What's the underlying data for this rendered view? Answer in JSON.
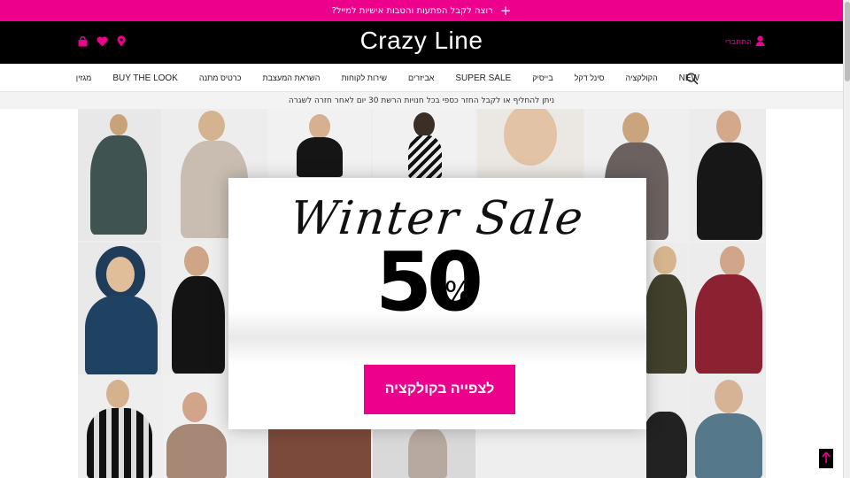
{
  "promo": {
    "text": "רוצה לקבל הפתעות והטבות אישיות למייל?",
    "icon": "plus-icon"
  },
  "header": {
    "logo": "Crazy Line",
    "signin_label": "התחברי",
    "icons": [
      "location-icon",
      "heart-icon",
      "cart-icon"
    ]
  },
  "nav": {
    "items": [
      {
        "label": "NEW"
      },
      {
        "label": "הקולקציה"
      },
      {
        "label": "סינל דקל"
      },
      {
        "label": "בייסיק"
      },
      {
        "label": "SUPER SALE"
      },
      {
        "label": "אביזרים"
      },
      {
        "label": "שירות לקוחות"
      },
      {
        "label": "השראת המעצבת"
      },
      {
        "label": "כרטיס מתנה"
      },
      {
        "label": "BUY THE LOOK"
      },
      {
        "label": "מגזין"
      }
    ],
    "search_icon": "search-icon"
  },
  "notice": {
    "text": "ניתן להחליף או לקבל החזר כספי בכל חנויות הרשת 30 יום לאחר חזרה לשגרה"
  },
  "hero": {
    "title": "Winter Sale",
    "discount": "50",
    "percent": "%",
    "cta": "לצפייה בקולקציה"
  },
  "colors": {
    "accent": "#ec008c",
    "header_bg": "#000000",
    "notice_bg": "#f3f3f3"
  }
}
